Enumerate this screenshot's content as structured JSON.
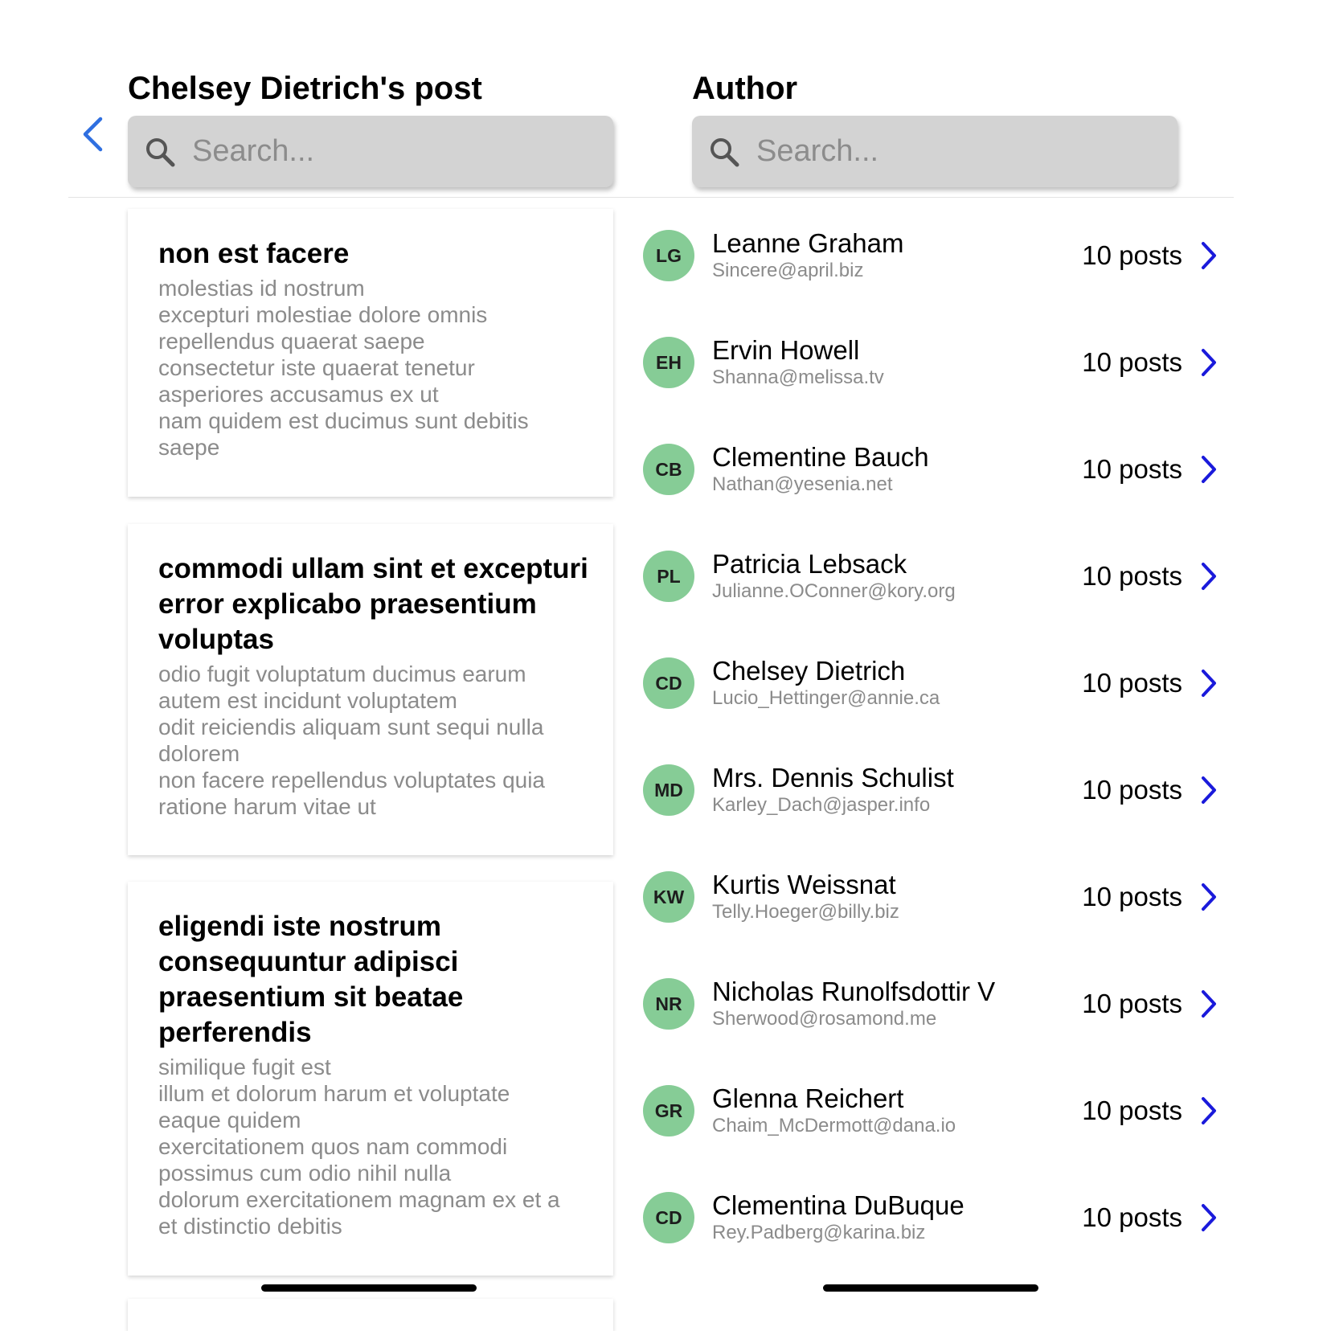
{
  "posts_column": {
    "title": "Chelsey Dietrich's post",
    "search_placeholder": "Search...",
    "posts": [
      {
        "title": "non est facere",
        "body": "molestias id nostrum\nexcepturi molestiae dolore omnis\nrepellendus quaerat saepe\nconsectetur iste quaerat tenetur\nasperiores accusamus ex ut\nnam quidem est ducimus sunt debitis\nsaepe"
      },
      {
        "title": "commodi ullam sint et excepturi error explicabo praesentium voluptas",
        "body": "odio fugit voluptatum ducimus earum\nautem est incidunt voluptatem\nodit reiciendis aliquam sunt sequi nulla\ndolorem\nnon facere repellendus voluptates quia\nratione harum vitae ut"
      },
      {
        "title": "eligendi iste nostrum consequuntur adipisci praesentium sit beatae perferendis",
        "body": "similique fugit est\nillum et dolorum harum et voluptate\neaque quidem\nexercitationem quos nam commodi\npossimus cum odio nihil nulla\ndolorum exercitationem magnam ex et a\net distinctio debitis"
      }
    ]
  },
  "authors_column": {
    "title": "Author",
    "search_placeholder": "Search...",
    "authors": [
      {
        "initials": "LG",
        "name": "Leanne Graham",
        "email": "Sincere@april.biz",
        "posts": "10 posts"
      },
      {
        "initials": "EH",
        "name": "Ervin Howell",
        "email": "Shanna@melissa.tv",
        "posts": "10 posts"
      },
      {
        "initials": "CB",
        "name": "Clementine Bauch",
        "email": "Nathan@yesenia.net",
        "posts": "10 posts"
      },
      {
        "initials": "PL",
        "name": "Patricia Lebsack",
        "email": "Julianne.OConner@kory.org",
        "posts": "10 posts"
      },
      {
        "initials": "CD",
        "name": "Chelsey Dietrich",
        "email": "Lucio_Hettinger@annie.ca",
        "posts": "10 posts"
      },
      {
        "initials": "MD",
        "name": "Mrs. Dennis Schulist",
        "email": "Karley_Dach@jasper.info",
        "posts": "10 posts"
      },
      {
        "initials": "KW",
        "name": "Kurtis Weissnat",
        "email": "Telly.Hoeger@billy.biz",
        "posts": "10 posts"
      },
      {
        "initials": "NR",
        "name": "Nicholas Runolfsdottir V",
        "email": "Sherwood@rosamond.me",
        "posts": "10 posts"
      },
      {
        "initials": "GR",
        "name": "Glenna Reichert",
        "email": "Chaim_McDermott@dana.io",
        "posts": "10 posts"
      },
      {
        "initials": "CD",
        "name": "Clementina DuBuque",
        "email": "Rey.Padberg@karina.biz",
        "posts": "10 posts"
      }
    ]
  },
  "icons": {
    "back": "chevron-left-icon",
    "search": "search-icon",
    "row_arrow": "chevron-right-icon"
  },
  "colors": {
    "back_chevron": "#2f6fe0",
    "row_chevron": "#1a1adb",
    "avatar_bg": "#86cc96",
    "search_bg": "#d3d3d3",
    "muted_text": "#8b8b8b"
  }
}
